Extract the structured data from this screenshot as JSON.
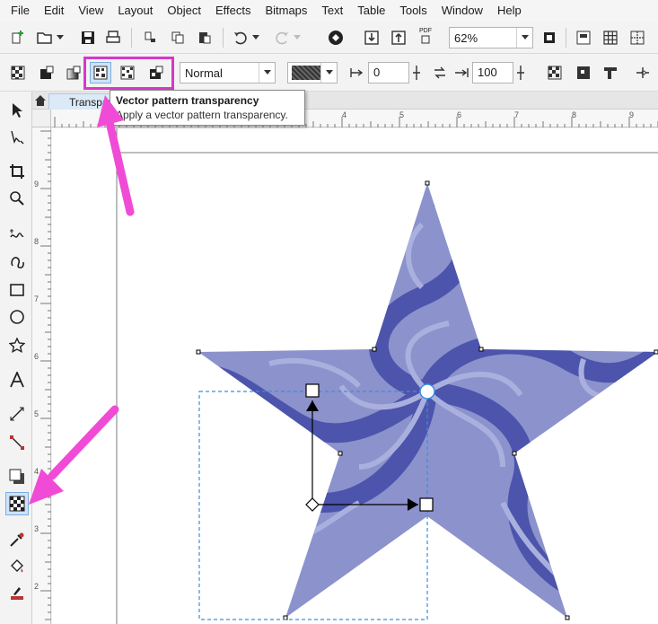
{
  "menu": [
    "File",
    "Edit",
    "View",
    "Layout",
    "Object",
    "Effects",
    "Bitmaps",
    "Text",
    "Table",
    "Tools",
    "Window",
    "Help"
  ],
  "toolbar": {
    "zoom_value": "62%",
    "pdf_label": "PDF"
  },
  "property_bar": {
    "merge_mode": "Normal",
    "start_transparency": "0",
    "end_transparency": "100"
  },
  "document_tab": {
    "label": "Transparency"
  },
  "tooltip": {
    "title": "Vector pattern transparency",
    "description": "Apply a vector pattern transparency."
  },
  "ruler": {
    "h_ticks": [
      "4",
      "5",
      "6",
      "7",
      "8",
      "9"
    ],
    "v_ticks": [
      "9",
      "8",
      "7",
      "6",
      "5",
      "4",
      "3",
      "2"
    ]
  },
  "colors": {
    "annotation_pink": "#f04bd6",
    "star_light": "#8c92cc",
    "star_dark": "#4c54ac",
    "selection_blue": "#3b8de0",
    "highlight_box": "#d439c9"
  }
}
